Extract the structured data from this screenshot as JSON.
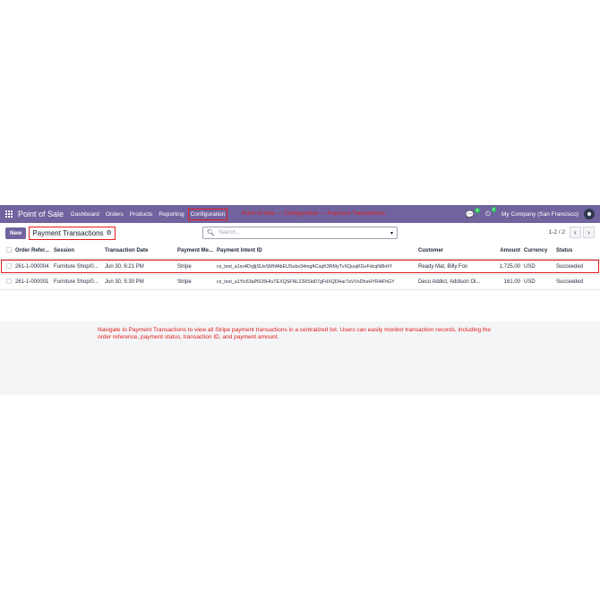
{
  "navbar": {
    "brand": "Point of Sale",
    "menu": [
      "Dashboard",
      "Orders",
      "Products",
      "Reporting"
    ],
    "active_menu": "Configuration",
    "annotation": "Point of Sale --- Configuration --- Payment Transactions",
    "chat_badge": "5",
    "activity_badge": "4",
    "company": "My Company (San Francisco)"
  },
  "control": {
    "new_label": "New",
    "breadcrumb": "Payment Transactions",
    "search_placeholder": "Search...",
    "pager": "1-2 / 2"
  },
  "table": {
    "headers": [
      "Order Refer...",
      "Session",
      "Transaction Date",
      "Payment Me...",
      "Payment Intent ID",
      "Customer",
      "Amount",
      "Currency",
      "Status"
    ],
    "rows": [
      [
        "261-1-000004",
        "Furniture Shop/0...",
        "Jun 30, 6:21 PM",
        "Stripe",
        "cs_test_a1sv4DrjjtjSUeSMhfAbEUSubx34mgACxgK3RMyTvXQuujKGvFdcqN8kHY",
        "Ready Mat, Billy Fox",
        "1,725.00",
        "USD",
        "Succeeded"
      ],
      [
        "261-1-000001",
        "Furniture Shop/0...",
        "Jun 30, 5:30 PM",
        "Stripe",
        "cs_test_a1Yic63aP6O5HIuTEXQSFNL22RSId07gFdXQDHar7aVVsDheHYR4tFhGY",
        "Deco Addict, Addison Ol...",
        "161.00",
        "USD",
        "Succeeded"
      ]
    ]
  },
  "annotation_text": "Navigate to Payment Transactions to view all Stripe payment transactions in a centralized list. Users can easily monitor transaction records, including the order reference, payment status, transaction ID, and payment amount.",
  "colors": {
    "navbar": "#71639e",
    "highlight": "#e11d1d"
  }
}
